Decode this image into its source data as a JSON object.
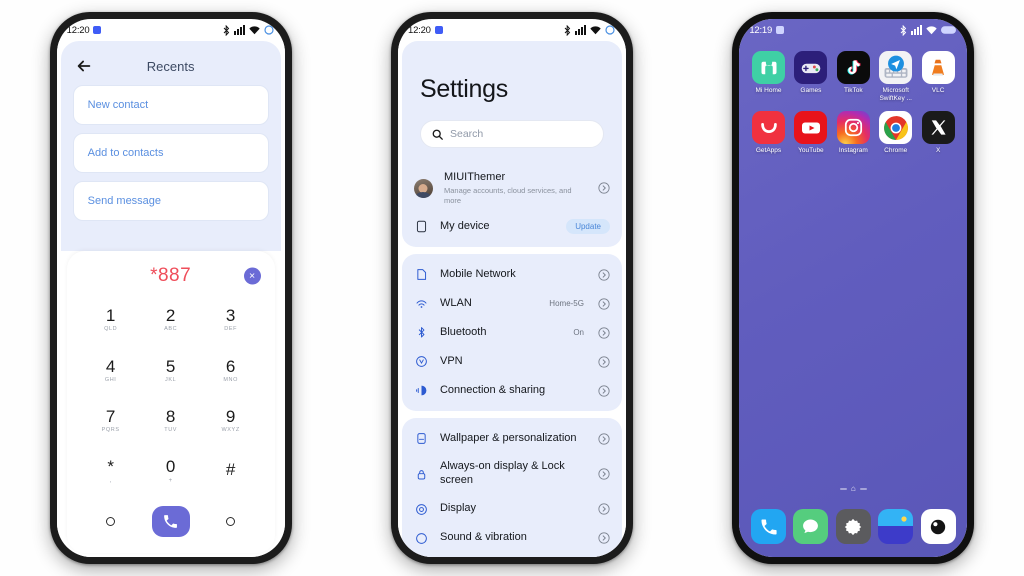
{
  "page": {
    "background": "#ffffff",
    "device_count": 3
  },
  "phone1": {
    "statusbar": {
      "time": "12:20",
      "icons": [
        "bluetooth-icon",
        "signal-icon",
        "wifi-icon",
        "circle-icon"
      ]
    },
    "header": {
      "back_icon": "back-arrow-icon",
      "title": "Recents"
    },
    "actions": [
      {
        "label": "New contact"
      },
      {
        "label": "Add to contacts"
      },
      {
        "label": "Send message"
      }
    ],
    "dialer": {
      "number": "*887",
      "delete_icon": "delete-circle-icon",
      "number_color": "#ef4d5a",
      "keys": [
        {
          "digit": "1",
          "letters": "QLD"
        },
        {
          "digit": "2",
          "letters": "ABC"
        },
        {
          "digit": "3",
          "letters": "DEF"
        },
        {
          "digit": "4",
          "letters": "GHI"
        },
        {
          "digit": "5",
          "letters": "JKL"
        },
        {
          "digit": "6",
          "letters": "MNO"
        },
        {
          "digit": "7",
          "letters": "PQRS"
        },
        {
          "digit": "8",
          "letters": "TUV"
        },
        {
          "digit": "9",
          "letters": "WXYZ"
        },
        {
          "digit": "*",
          "letters": ","
        },
        {
          "digit": "0",
          "letters": "+"
        },
        {
          "digit": "#",
          "letters": ""
        }
      ],
      "call_icon": "call-icon",
      "call_button_color": "#6b6bd6",
      "left_circle_icon": "circle-outline-icon",
      "right_circle_icon": "circle-outline-icon"
    }
  },
  "phone2": {
    "statusbar": {
      "time": "12:20",
      "icons": [
        "bluetooth-icon",
        "signal-icon",
        "wifi-icon",
        "circle-icon"
      ]
    },
    "title": "Settings",
    "search": {
      "placeholder": "Search",
      "icon": "search-icon"
    },
    "account": {
      "name": "MIUIThemer",
      "subtitle": "Manage accounts, cloud services, and more",
      "avatar": "avatar"
    },
    "device": {
      "label": "My device",
      "badge": "Update",
      "icon": "device-icon"
    },
    "section_network": [
      {
        "label": "Mobile Network",
        "value": "",
        "icon": "sim-card-icon"
      },
      {
        "label": "WLAN",
        "value": "Home-5G",
        "icon": "wifi-icon"
      },
      {
        "label": "Bluetooth",
        "value": "On",
        "icon": "bluetooth-icon"
      },
      {
        "label": "VPN",
        "value": "",
        "icon": "vpn-icon"
      },
      {
        "label": "Connection & sharing",
        "value": "",
        "icon": "connection-sharing-icon"
      }
    ],
    "section_display": [
      {
        "label": "Wallpaper & personalization",
        "value": "",
        "icon": "wallpaper-icon"
      },
      {
        "label": "Always-on display & Lock screen",
        "value": "",
        "icon": "lock-icon"
      },
      {
        "label": "Display",
        "value": "",
        "icon": "display-icon"
      },
      {
        "label": "Sound & vibration",
        "value": "",
        "icon": "sound-icon"
      }
    ]
  },
  "phone3": {
    "statusbar": {
      "time": "12:19",
      "icons": [
        "bluetooth-icon",
        "signal-icon",
        "wifi-icon",
        "battery-icon"
      ]
    },
    "wallpaper_color": "#615dbe",
    "apps_row1": [
      {
        "label": "Mi Home",
        "icon": "mi-home-icon"
      },
      {
        "label": "Games",
        "icon": "games-icon"
      },
      {
        "label": "TikTok",
        "icon": "tiktok-icon"
      },
      {
        "label": "Microsoft SwiftKey ...",
        "icon": "swiftkey-icon"
      },
      {
        "label": "VLC",
        "icon": "vlc-icon"
      }
    ],
    "apps_row2": [
      {
        "label": "GetApps",
        "icon": "getapps-icon"
      },
      {
        "label": "YouTube",
        "icon": "youtube-icon"
      },
      {
        "label": "Instagram",
        "icon": "instagram-icon"
      },
      {
        "label": "Chrome",
        "icon": "chrome-icon"
      },
      {
        "label": "X",
        "icon": "x-icon"
      }
    ],
    "dock": [
      {
        "label": "Phone",
        "icon": "phone-icon"
      },
      {
        "label": "Messages",
        "icon": "messages-icon"
      },
      {
        "label": "Settings",
        "icon": "settings-gear-icon"
      },
      {
        "label": "Gallery",
        "icon": "gallery-icon"
      },
      {
        "label": "Camera",
        "icon": "camera-icon"
      }
    ],
    "home_indicator_icon": "home-indicator-icon"
  }
}
